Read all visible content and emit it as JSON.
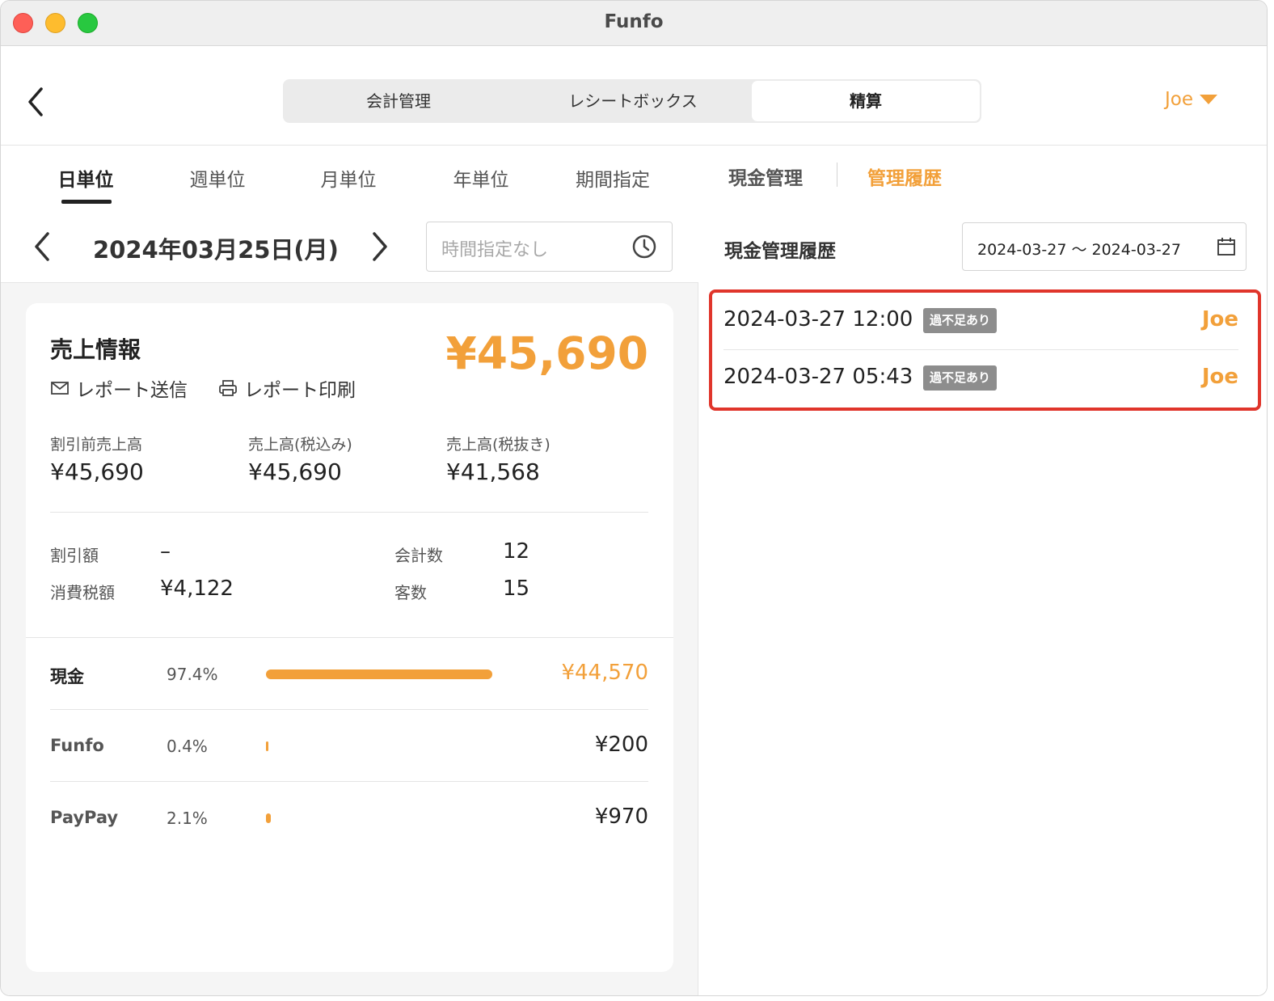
{
  "window": {
    "title": "Funfo"
  },
  "header": {
    "segments": [
      "会計管理",
      "レシートボックス",
      "精算"
    ],
    "user": "Joe"
  },
  "left": {
    "period_tabs": [
      "日単位",
      "週単位",
      "月単位",
      "年単位",
      "期間指定"
    ],
    "active_period_tab": "日単位",
    "date": "2024年03月25日(月)",
    "time_placeholder": "時間指定なし",
    "card": {
      "title": "売上情報",
      "total": "¥45,690",
      "send_report": "レポート送信",
      "print_report": "レポート印刷",
      "stats": [
        {
          "label": "割引前売上高",
          "value": "¥45,690"
        },
        {
          "label": "売上高(税込み)",
          "value": "¥45,690"
        },
        {
          "label": "売上高(税抜き)",
          "value": "¥41,568"
        }
      ],
      "discount_label": "割引額",
      "discount_value": "–",
      "tax_label": "消費税額",
      "tax_value": "¥4,122",
      "transactions_label": "会計数",
      "transactions_value": "12",
      "customers_label": "客数",
      "customers_value": "15",
      "payments": [
        {
          "name": "現金",
          "percent": "97.4%",
          "share": 0.974,
          "amount": "¥44,570"
        },
        {
          "name": "Funfo",
          "percent": "0.4%",
          "share": 0.004,
          "amount": "¥200"
        },
        {
          "name": "PayPay",
          "percent": "2.1%",
          "share": 0.021,
          "amount": "¥970"
        }
      ]
    }
  },
  "right": {
    "tabs": [
      "現金管理",
      "管理履歴"
    ],
    "active_tab": "管理履歴",
    "history_title": "現金管理履歴",
    "date_range": "2024-03-27 ～ 2024-03-27",
    "history": [
      {
        "time": "2024-03-27 12:00",
        "badge": "過不足あり",
        "user": "Joe"
      },
      {
        "time": "2024-03-27 05:43",
        "badge": "過不足あり",
        "user": "Joe"
      }
    ]
  },
  "colors": {
    "accent": "#f2a03a",
    "highlight": "#e0352b",
    "badge": "#8d8d8d"
  },
  "icons": [
    "back-chevron-icon",
    "caret-down-icon",
    "chevron-left-icon",
    "chevron-right-icon",
    "clock-icon",
    "mail-icon",
    "printer-icon",
    "calendar-icon"
  ]
}
